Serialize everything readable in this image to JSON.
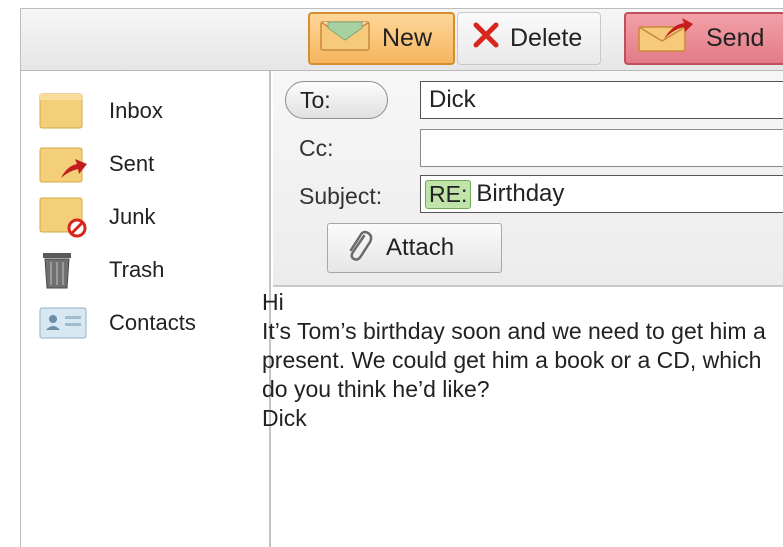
{
  "toolbar": {
    "new_label": "New",
    "delete_label": "Delete",
    "send_label": "Send"
  },
  "sidebar": {
    "items": [
      {
        "label": "Inbox",
        "icon": "folder-icon"
      },
      {
        "label": "Sent",
        "icon": "folder-sent-icon"
      },
      {
        "label": "Junk",
        "icon": "folder-junk-icon"
      },
      {
        "label": "Trash",
        "icon": "trash-icon"
      },
      {
        "label": "Contacts",
        "icon": "contact-card-icon"
      }
    ]
  },
  "compose": {
    "to_label": "To:",
    "to_value": "Dick",
    "cc_label": "Cc:",
    "cc_value": "",
    "subject_label": "Subject:",
    "subject_prefix": "RE:",
    "subject_value": "Birthday",
    "attach_label": "Attach",
    "body": "Hi\nIt’s Tom’s birthday soon and we need to get him a present. We could get him a book or a CD, which do you think he’d like?\nDick"
  },
  "colors": {
    "new_button": "#f5b55e",
    "send_button": "#e27b86",
    "delete_x": "#d8261d",
    "re_tag": "#bfe3a8",
    "folder": "#f3cf7a"
  }
}
